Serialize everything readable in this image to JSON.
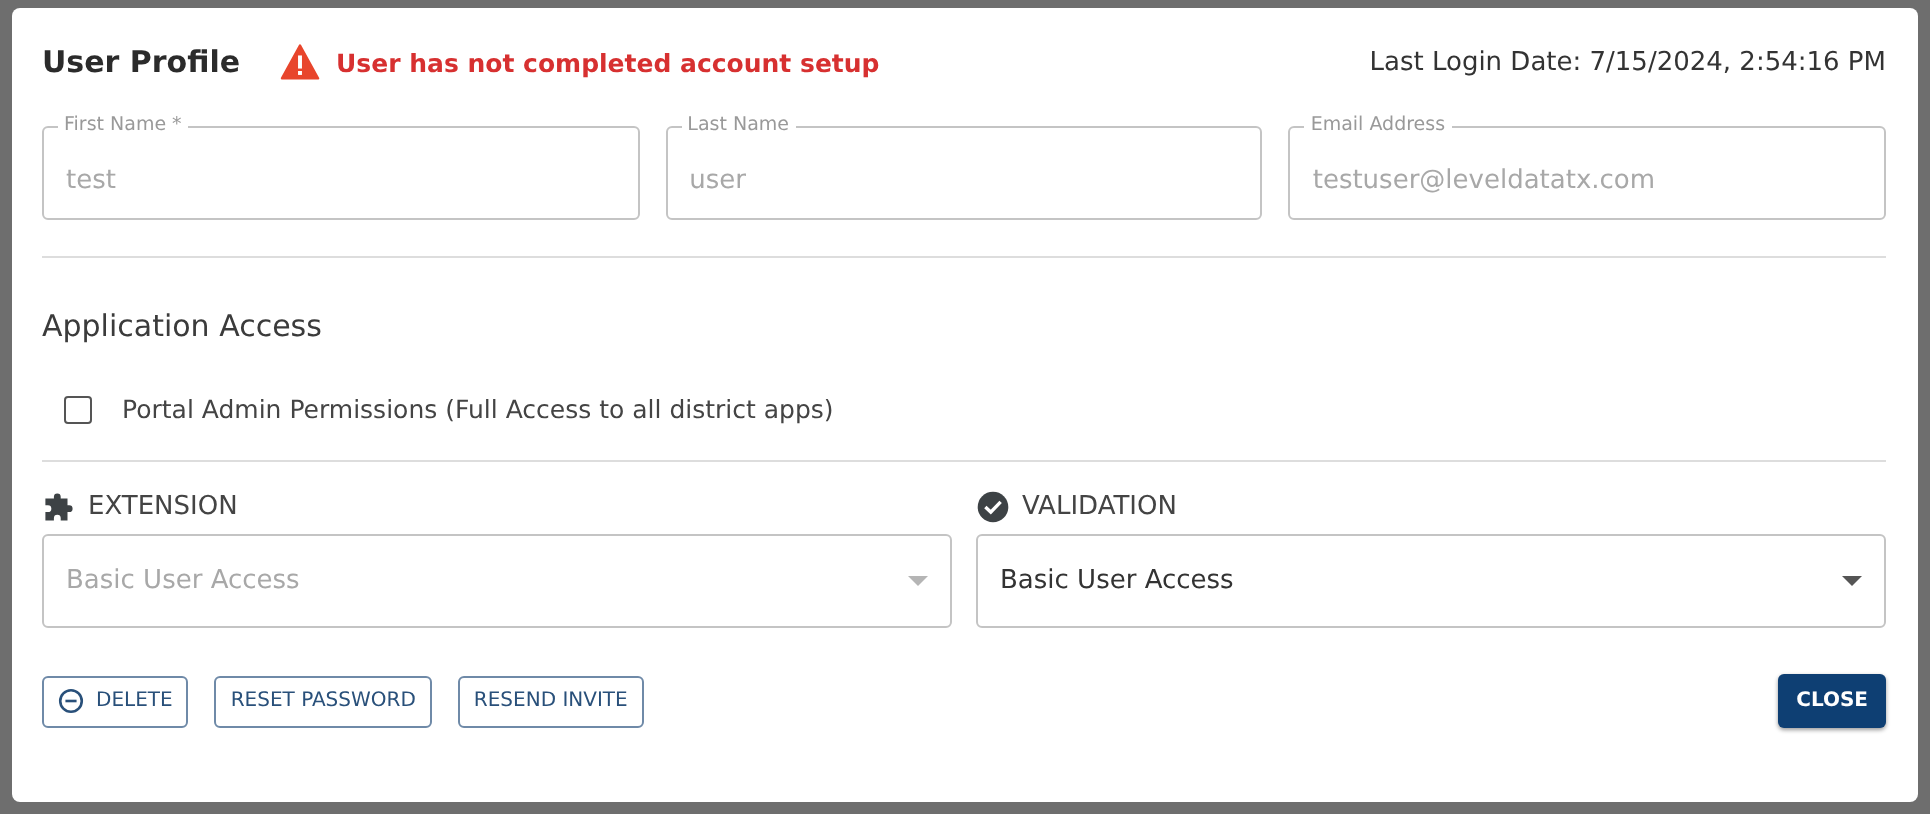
{
  "dialog": {
    "title": "User Profile",
    "warning": "User has not completed account setup",
    "last_login": "Last Login Date: 7/15/2024, 2:54:16 PM"
  },
  "fields": [
    {
      "label": "First Name *",
      "value": "test",
      "disabled": true
    },
    {
      "label": "Last Name",
      "value": "user",
      "disabled": true
    },
    {
      "label": "Email Address",
      "value": "testuser@leveldatatx.com",
      "disabled": true
    }
  ],
  "application_access": {
    "heading": "Application Access",
    "permission": {
      "label": "Portal Admin Permissions (Full Access to all district apps)",
      "checked": false
    }
  },
  "apps": [
    {
      "kind": "extension",
      "name": "EXTENSION",
      "value": "Basic User Access",
      "disabled": true
    },
    {
      "kind": "validation",
      "name": "VALIDATION",
      "value": "Basic User Access",
      "disabled": false
    }
  ],
  "buttons": [
    {
      "kind": "delete",
      "label": "DELETE"
    },
    {
      "kind": "outline",
      "label": "RESET PASSWORD"
    },
    {
      "kind": "outline",
      "label": "RESEND INVITE"
    }
  ],
  "close_button": "CLOSE"
}
